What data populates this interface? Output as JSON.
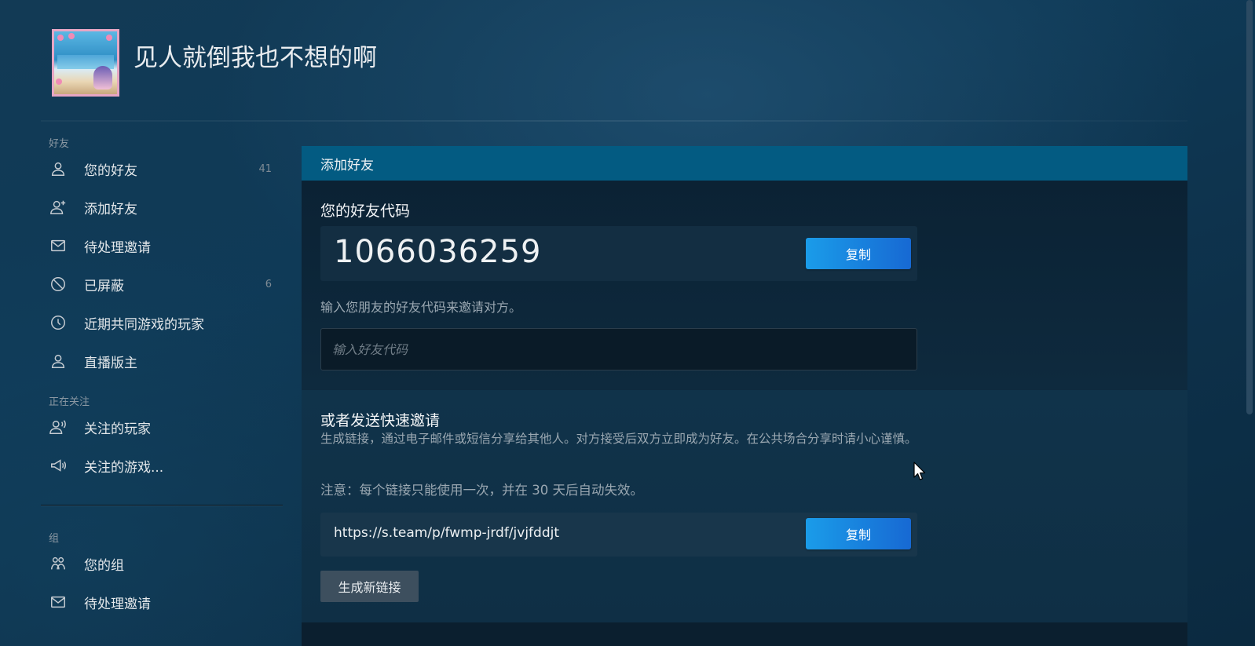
{
  "profile": {
    "name": "见人就倒我也不想的啊"
  },
  "sidebar": {
    "friends_section_label": "好友",
    "friends_items": [
      {
        "label": "您的好友",
        "count": "41",
        "icon": "person-icon"
      },
      {
        "label": "添加好友",
        "count": "",
        "icon": "add-person-icon"
      },
      {
        "label": "待处理邀请",
        "count": "",
        "icon": "envelope-icon"
      },
      {
        "label": "已屏蔽",
        "count": "6",
        "icon": "block-icon"
      },
      {
        "label": "近期共同游戏的玩家",
        "count": "",
        "icon": "clock-icon"
      },
      {
        "label": "直播版主",
        "count": "",
        "icon": "person-icon"
      }
    ],
    "following_section_label": "正在关注",
    "following_items": [
      {
        "label": "关注的玩家",
        "icon": "person-broadcast-icon"
      },
      {
        "label": "关注的游戏...",
        "icon": "megaphone-icon"
      }
    ],
    "groups_section_label": "组",
    "groups_items": [
      {
        "label": "您的组",
        "icon": "group-icon"
      },
      {
        "label": "待处理邀请",
        "icon": "envelope-icon"
      }
    ]
  },
  "main": {
    "panel_title": "添加好友",
    "friend_code_title": "您的好友代码",
    "friend_code": "1066036259",
    "copy_label": "复制",
    "enter_hint": "输入您朋友的好友代码来邀请对方。",
    "input_placeholder": "输入好友代码",
    "quick_invite_title": "或者发送快速邀请",
    "quick_invite_desc": "生成链接，通过电子邮件或短信分享给其他人。对方接受后双方立即成为好友。在公共场合分享时请小心谨慎。",
    "quick_invite_note": "注意：每个链接只能使用一次，并在 30 天后自动失效。",
    "invite_link": "https://s.team/p/fwmp-jrdf/jvjfddjt",
    "copy_link_label": "复制",
    "generate_label": "生成新链接"
  },
  "colors": {
    "panel_header": "#035b82",
    "button_blue_start": "#1a9ce9",
    "button_blue_end": "#1769d3",
    "button_gray": "#3d4f5e"
  }
}
